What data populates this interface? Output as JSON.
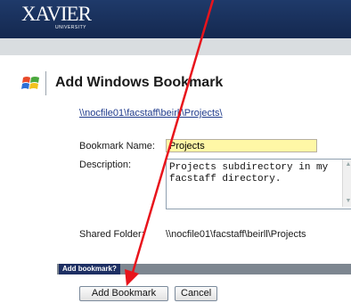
{
  "header": {
    "logo_text": "XAVIER",
    "logo_subtext": "UNIVERSITY",
    "background_color": "#1f3a6a"
  },
  "page": {
    "title": "Add Windows Bookmark",
    "icon": "windows-logo-icon"
  },
  "form": {
    "path_link": "\\\\nocfile01\\facstaff\\beirll\\Projects\\",
    "bookmark_name_label": "Bookmark Name:",
    "bookmark_name_value": "Projects",
    "description_label": "Description:",
    "description_line1": "Projects subdirectory in my",
    "description_line2": "facstaff directory.",
    "shared_folder_label": "Shared Folder:",
    "shared_folder_value": "\\\\nocfile01\\facstaff\\beirll\\Projects"
  },
  "section": {
    "label": "Add bookmark?"
  },
  "buttons": {
    "add_label": "Add Bookmark",
    "cancel_label": "Cancel"
  },
  "annotation": {
    "arrow_color": "#e8141c",
    "arrow_icon": "red-arrow-annotation"
  }
}
